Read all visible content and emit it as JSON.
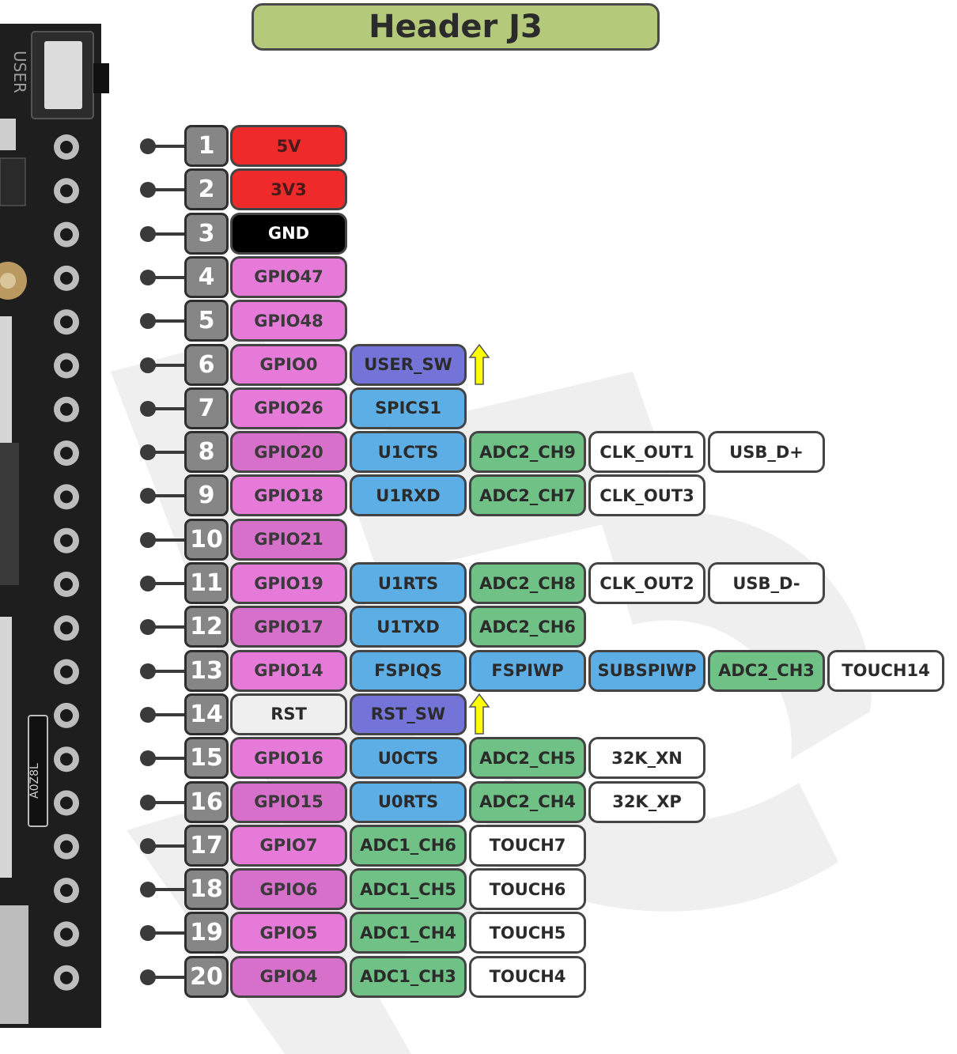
{
  "title": "Header J3",
  "board": {
    "silk_text": "USER",
    "chip_marking": "A0Z8L"
  },
  "colors": {
    "title_bg": "#b5c97b",
    "power": "#ee2a2a",
    "ground": "#000000",
    "gpio": "#e57ad8",
    "gpio_dark": "#d770cb",
    "button": "#7474d8",
    "serial": "#5eaee6",
    "spi": "#5eaee6",
    "adc": "#6fc185",
    "other": "#ffffff",
    "reset": "#efefef",
    "pin_number": "#868686",
    "arrow": "#ffff00"
  },
  "pins": [
    {
      "num": "1",
      "labels": [
        {
          "text": "5V",
          "kind": "power"
        }
      ]
    },
    {
      "num": "2",
      "labels": [
        {
          "text": "3V3",
          "kind": "power"
        }
      ]
    },
    {
      "num": "3",
      "labels": [
        {
          "text": "GND",
          "kind": "ground"
        }
      ]
    },
    {
      "num": "4",
      "labels": [
        {
          "text": "GPIO47",
          "kind": "gpio"
        }
      ]
    },
    {
      "num": "5",
      "labels": [
        {
          "text": "GPIO48",
          "kind": "gpio"
        }
      ]
    },
    {
      "num": "6",
      "labels": [
        {
          "text": "GPIO0",
          "kind": "gpio"
        },
        {
          "text": "USER_SW",
          "kind": "button"
        }
      ],
      "arrow": true
    },
    {
      "num": "7",
      "labels": [
        {
          "text": "GPIO26",
          "kind": "gpio"
        },
        {
          "text": "SPICS1",
          "kind": "spi"
        }
      ]
    },
    {
      "num": "8",
      "labels": [
        {
          "text": "GPIO20",
          "kind": "gpio"
        },
        {
          "text": "U1CTS",
          "kind": "serial"
        },
        {
          "text": "ADC2_CH9",
          "kind": "adc"
        },
        {
          "text": "CLK_OUT1",
          "kind": "other"
        },
        {
          "text": "USB_D+",
          "kind": "other"
        }
      ]
    },
    {
      "num": "9",
      "labels": [
        {
          "text": "GPIO18",
          "kind": "gpio"
        },
        {
          "text": "U1RXD",
          "kind": "serial"
        },
        {
          "text": "ADC2_CH7",
          "kind": "adc"
        },
        {
          "text": "CLK_OUT3",
          "kind": "other"
        }
      ]
    },
    {
      "num": "10",
      "labels": [
        {
          "text": "GPIO21",
          "kind": "gpio"
        }
      ]
    },
    {
      "num": "11",
      "labels": [
        {
          "text": "GPIO19",
          "kind": "gpio"
        },
        {
          "text": "U1RTS",
          "kind": "serial"
        },
        {
          "text": "ADC2_CH8",
          "kind": "adc"
        },
        {
          "text": "CLK_OUT2",
          "kind": "other"
        },
        {
          "text": "USB_D-",
          "kind": "other"
        }
      ]
    },
    {
      "num": "12",
      "labels": [
        {
          "text": "GPIO17",
          "kind": "gpio"
        },
        {
          "text": "U1TXD",
          "kind": "serial"
        },
        {
          "text": "ADC2_CH6",
          "kind": "adc"
        }
      ]
    },
    {
      "num": "13",
      "labels": [
        {
          "text": "GPIO14",
          "kind": "gpio"
        },
        {
          "text": "FSPIQS",
          "kind": "spi"
        },
        {
          "text": "FSPIWP",
          "kind": "spi"
        },
        {
          "text": "SUBSPIWP",
          "kind": "spi"
        },
        {
          "text": "ADC2_CH3",
          "kind": "adc"
        },
        {
          "text": "TOUCH14",
          "kind": "other"
        }
      ]
    },
    {
      "num": "14",
      "labels": [
        {
          "text": "RST",
          "kind": "reset"
        },
        {
          "text": "RST_SW",
          "kind": "button"
        }
      ],
      "arrow": true
    },
    {
      "num": "15",
      "labels": [
        {
          "text": "GPIO16",
          "kind": "gpio"
        },
        {
          "text": "U0CTS",
          "kind": "serial"
        },
        {
          "text": "ADC2_CH5",
          "kind": "adc"
        },
        {
          "text": "32K_XN",
          "kind": "other"
        }
      ]
    },
    {
      "num": "16",
      "labels": [
        {
          "text": "GPIO15",
          "kind": "gpio"
        },
        {
          "text": "U0RTS",
          "kind": "serial"
        },
        {
          "text": "ADC2_CH4",
          "kind": "adc"
        },
        {
          "text": "32K_XP",
          "kind": "other"
        }
      ]
    },
    {
      "num": "17",
      "labels": [
        {
          "text": "GPIO7",
          "kind": "gpio"
        },
        {
          "text": "ADC1_CH6",
          "kind": "adc"
        },
        {
          "text": "TOUCH7",
          "kind": "other"
        }
      ]
    },
    {
      "num": "18",
      "labels": [
        {
          "text": "GPIO6",
          "kind": "gpio"
        },
        {
          "text": "ADC1_CH5",
          "kind": "adc"
        },
        {
          "text": "TOUCH6",
          "kind": "other"
        }
      ]
    },
    {
      "num": "19",
      "labels": [
        {
          "text": "GPIO5",
          "kind": "gpio"
        },
        {
          "text": "ADC1_CH4",
          "kind": "adc"
        },
        {
          "text": "TOUCH5",
          "kind": "other"
        }
      ]
    },
    {
      "num": "20",
      "labels": [
        {
          "text": "GPIO4",
          "kind": "gpio"
        },
        {
          "text": "ADC1_CH3",
          "kind": "adc"
        },
        {
          "text": "TOUCH4",
          "kind": "other"
        }
      ]
    }
  ]
}
